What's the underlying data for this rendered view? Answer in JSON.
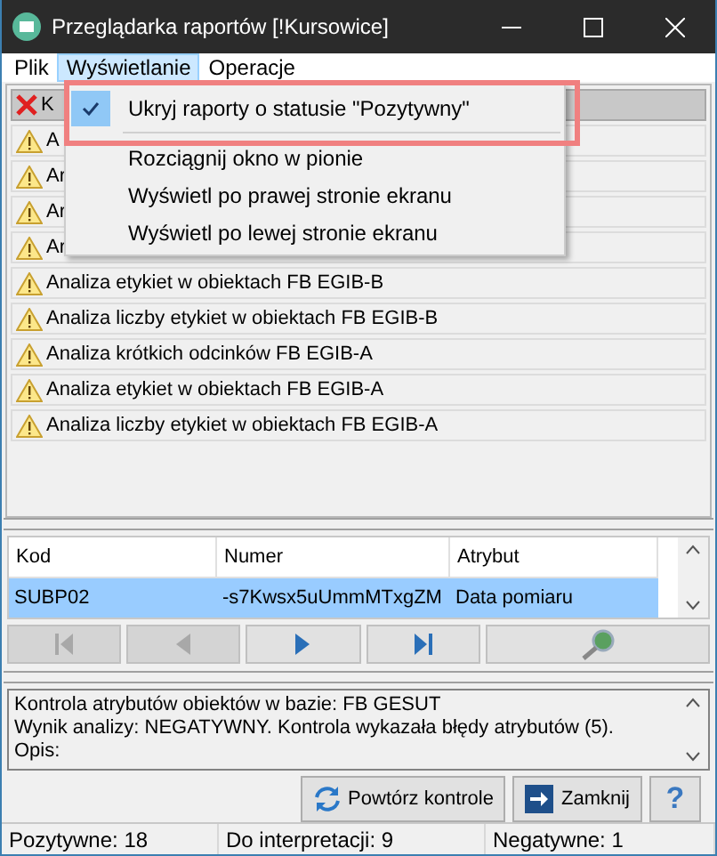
{
  "window": {
    "title": "Przeglądarka raportów [!Kursowice]"
  },
  "menu": [
    {
      "label": "Plik",
      "selected": false
    },
    {
      "label": "Wyświetlanie",
      "selected": true
    },
    {
      "label": "Operacje",
      "selected": false
    }
  ],
  "dropdown": [
    {
      "label": "Ukryj raporty o statusie \"Pozytywny\"",
      "checked": true
    },
    {
      "label": "Rozciągnij okno w pionie",
      "checked": false
    },
    {
      "label": "Wyświetl po prawej stronie ekranu",
      "checked": false
    },
    {
      "label": "Wyświetl po lewej stronie ekranu",
      "checked": false
    }
  ],
  "reports": [
    {
      "text": "K",
      "kind": "error",
      "selected": true
    },
    {
      "text": "A",
      "kind": "warning",
      "selected": false
    },
    {
      "text": "Ar",
      "kind": "warning",
      "selected": false
    },
    {
      "text": "Ar",
      "kind": "warning",
      "selected": false
    },
    {
      "text": "Ar",
      "kind": "warning",
      "selected": false
    },
    {
      "text": "Analiza etykiet w obiektach FB EGIB-B",
      "kind": "warning",
      "selected": false
    },
    {
      "text": "Analiza liczby etykiet w obiektach FB EGIB-B",
      "kind": "warning",
      "selected": false
    },
    {
      "text": "Analiza krótkich odcinków FB EGIB-A",
      "kind": "warning",
      "selected": false
    },
    {
      "text": "Analiza etykiet w obiektach FB EGIB-A",
      "kind": "warning",
      "selected": false
    },
    {
      "text": "Analiza liczby etykiet w obiektach FB EGIB-A",
      "kind": "warning",
      "selected": false
    }
  ],
  "grid": {
    "columns": [
      "Kod",
      "Numer",
      "Atrybut"
    ],
    "rows": [
      {
        "cells": [
          "SUBP02",
          "-s7Kwsx5uUmmMTxgZM",
          "Data pomiaru"
        ],
        "selected": true
      }
    ]
  },
  "nav": [
    {
      "kind": "first",
      "disabled": true
    },
    {
      "kind": "prev",
      "disabled": true
    },
    {
      "kind": "next",
      "disabled": false
    },
    {
      "kind": "last",
      "disabled": false
    },
    {
      "kind": "search",
      "disabled": false
    }
  ],
  "details": [
    "Kontrola atrybutów obiektów w bazie: FB GESUT",
    "Wynik analizy: NEGATYWNY. Kontrola wykazała błędy atrybutów (5).",
    "Opis:"
  ],
  "buttons": [
    {
      "kind": "refresh",
      "label": "Powtórz kontrole"
    },
    {
      "kind": "exit",
      "label": "Zamknij"
    },
    {
      "kind": "help",
      "label": "?"
    }
  ],
  "status_bar": [
    "Pozytywne: 18",
    "Do interpretacji: 9",
    "Negatywne: 1"
  ]
}
